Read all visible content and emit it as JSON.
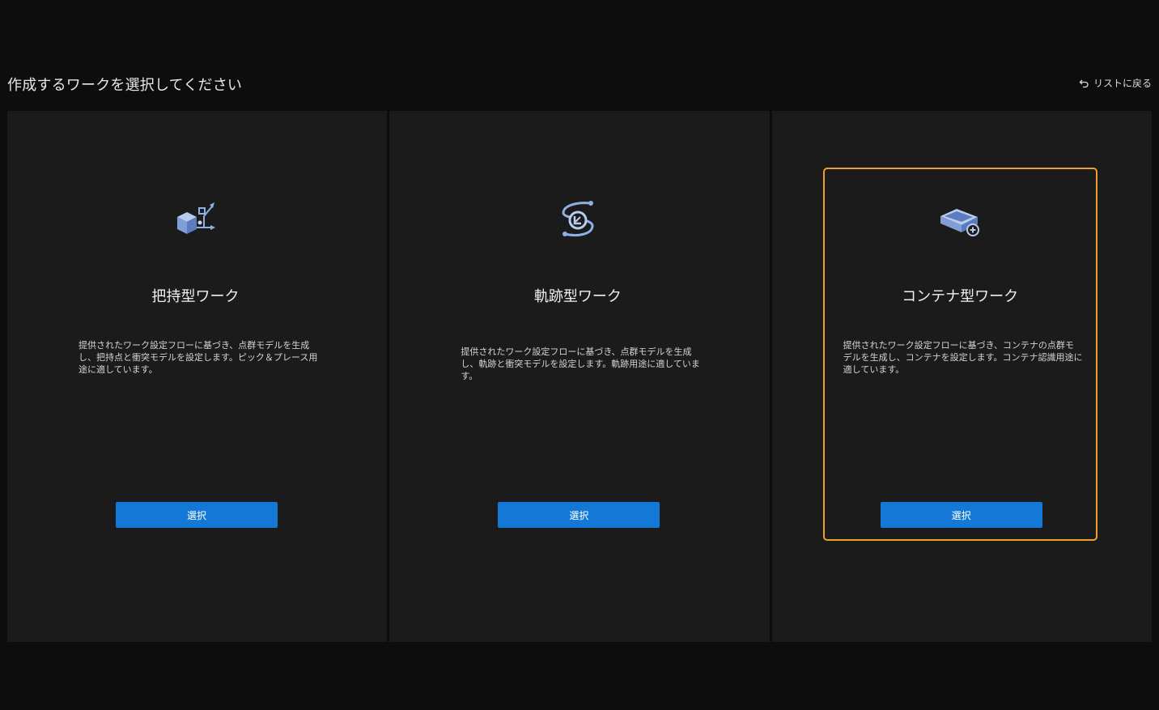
{
  "header": {
    "title": "作成するワークを選択してください",
    "back_label": "リストに戻る",
    "back_icon": "undo-arrow-icon"
  },
  "colors": {
    "background": "#0d0d0d",
    "panel": "#1b1b1b",
    "accent_button": "#1479d6",
    "selected_border": "#f0a028",
    "icon_blue": "#8fb0e6"
  },
  "cards": [
    {
      "icon": "grasp-box-icon",
      "title": "把持型ワーク",
      "description": "提供されたワーク設定フローに基づき、点群モデルを生成し、把持点と衝突モデルを設定します。ピック＆プレース用途に適しています。",
      "button_label": "選択",
      "selected": false
    },
    {
      "icon": "trajectory-path-icon",
      "title": "軌跡型ワーク",
      "description": "提供されたワーク設定フローに基づき、点群モデルを生成し、軌跡と衝突モデルを設定します。軌跡用途に適しています。",
      "button_label": "選択",
      "selected": false
    },
    {
      "icon": "container-add-icon",
      "title": "コンテナ型ワーク",
      "description": "提供されたワーク設定フローに基づき、コンテナの点群モデルを生成し、コンテナを設定します。コンテナ認識用途に適しています。",
      "button_label": "選択",
      "selected": true
    }
  ]
}
